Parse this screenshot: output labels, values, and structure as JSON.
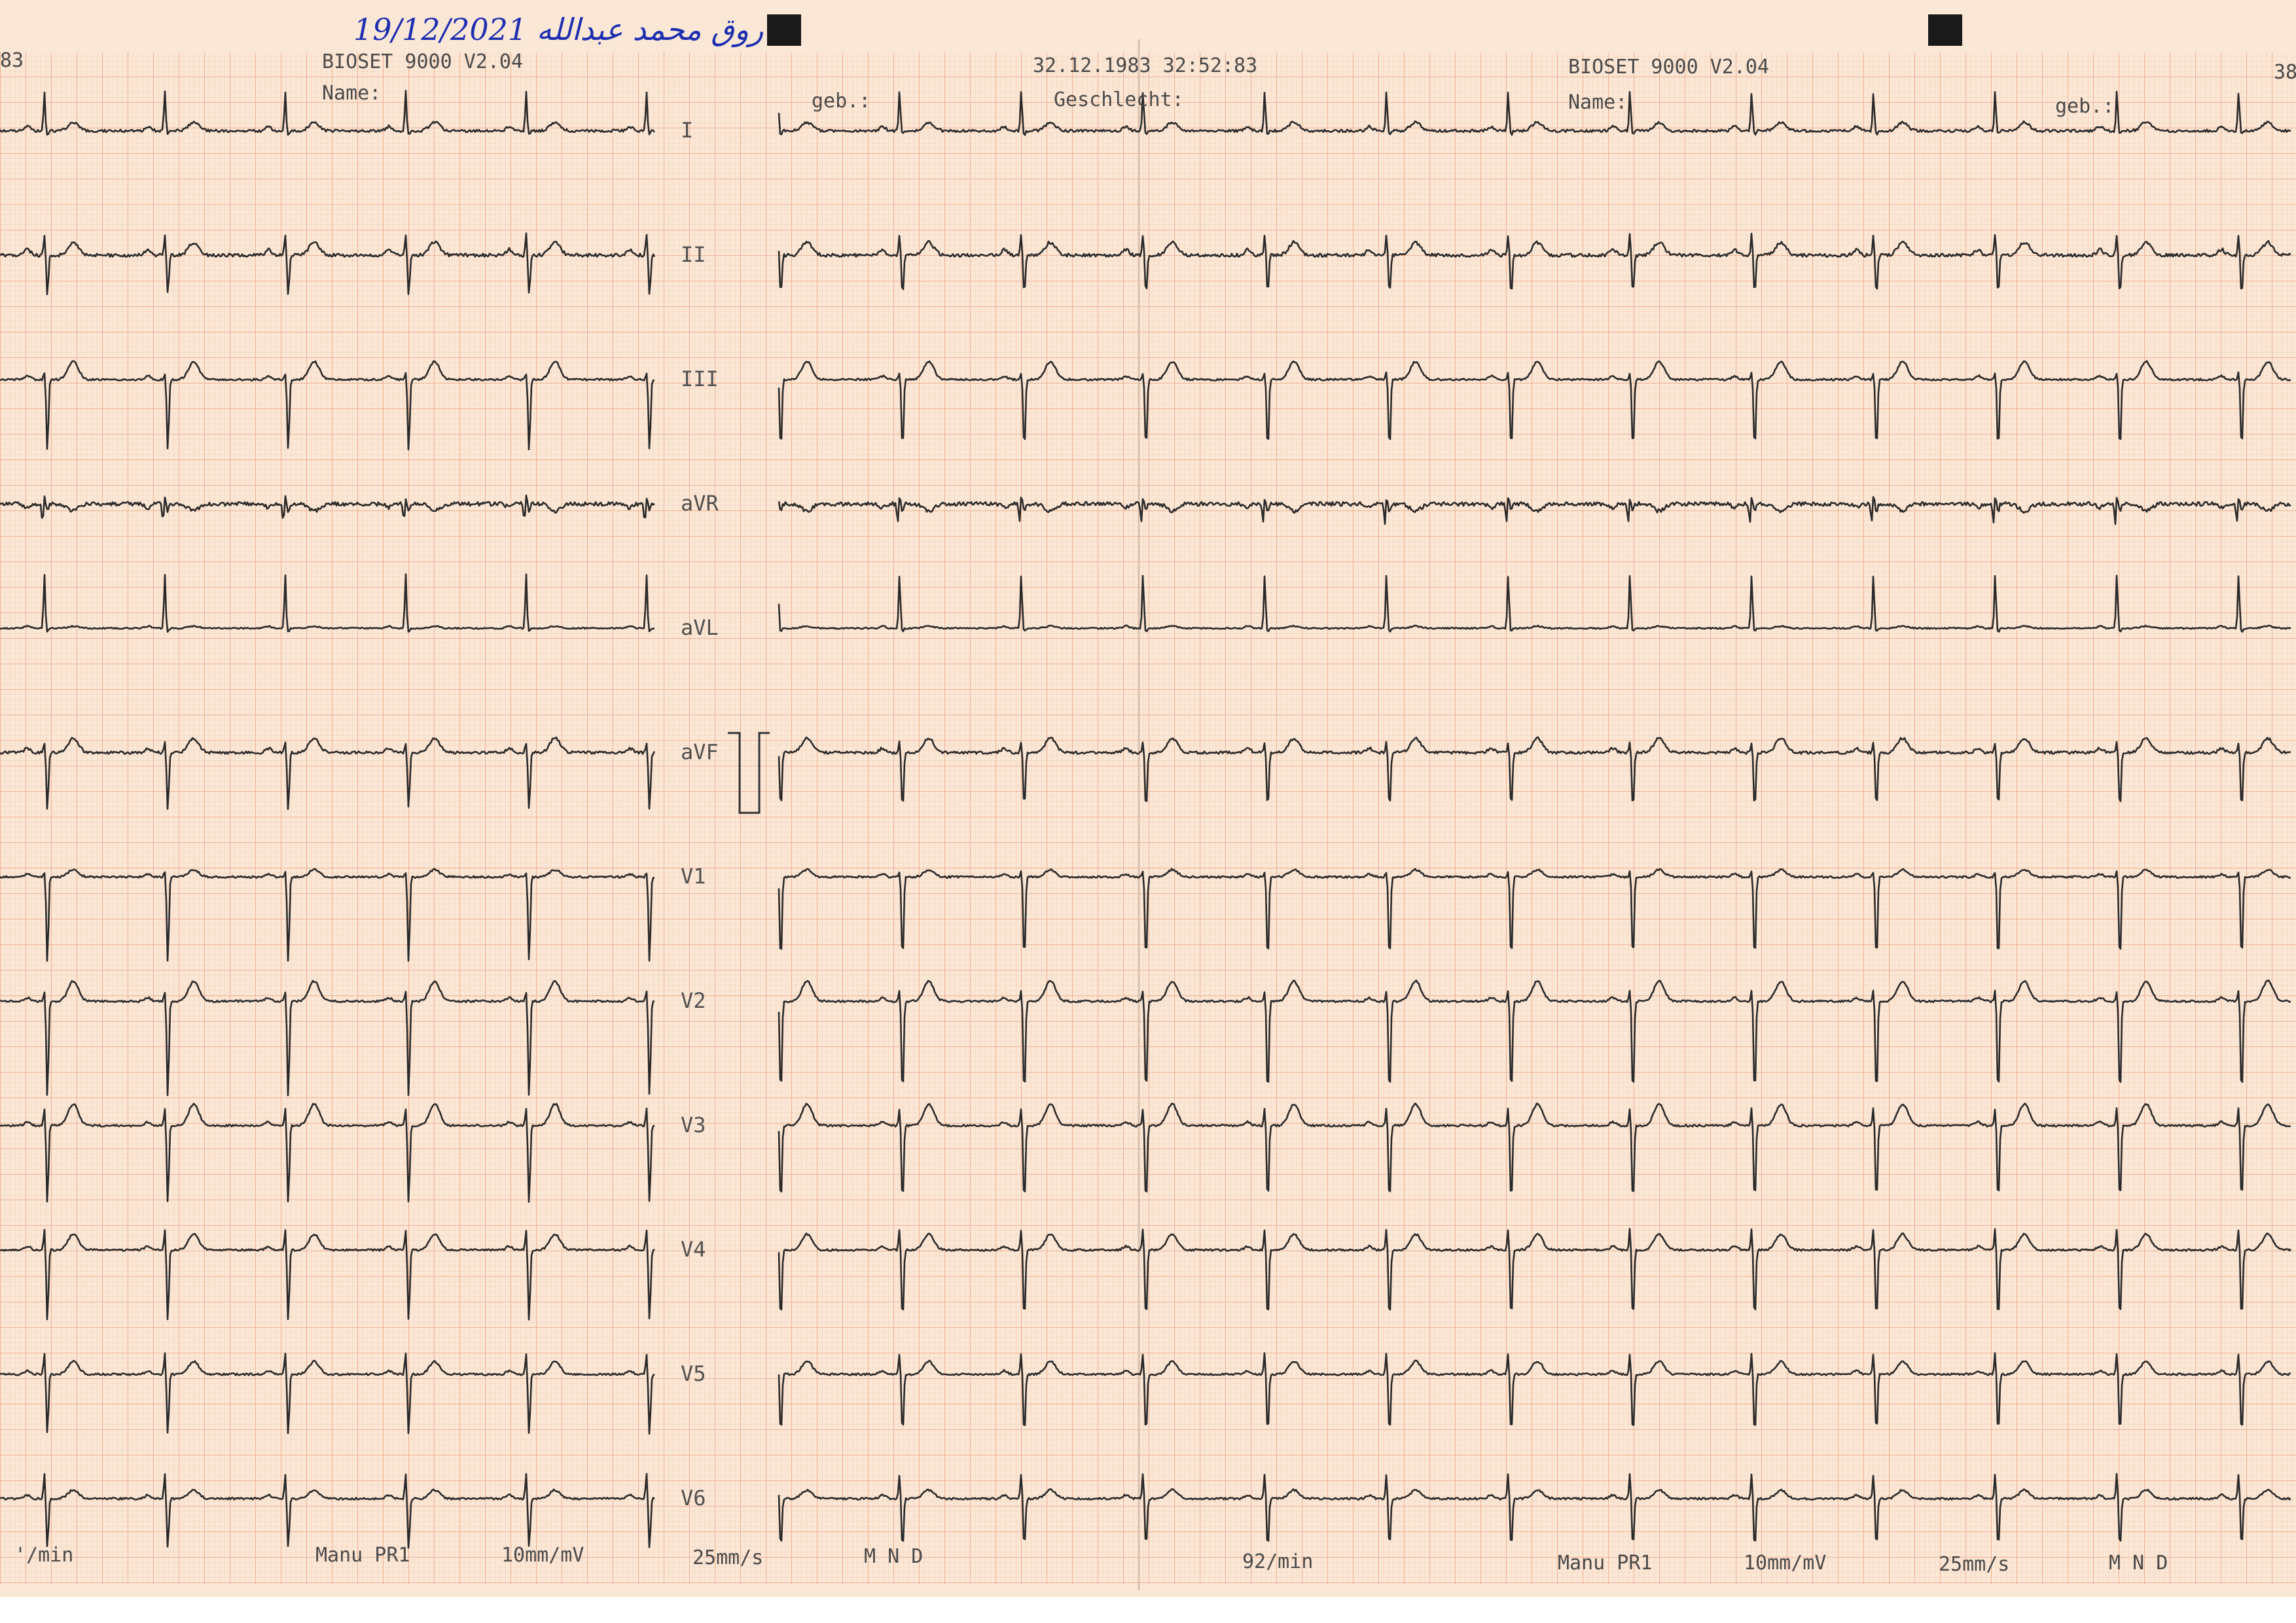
{
  "handwritten_note": "فاروق محمد عبدالله 19/12/2021",
  "header_left": {
    "number": "83",
    "device": "BIOSET 9000 V2.04",
    "name_label": "Name:",
    "geb_label": "geb.:",
    "datetime": "32.12.1983 32:52:83",
    "geschlecht_label": "Geschlecht:"
  },
  "header_right": {
    "device": "BIOSET 9000 V2.04",
    "name_label": "Name:",
    "geb_label": "geb.:",
    "number": "38"
  },
  "leads": [
    "I",
    "II",
    "III",
    "aVR",
    "aVL",
    "aVF",
    "V1",
    "V2",
    "V3",
    "V4",
    "V5",
    "V6"
  ],
  "footer_left": {
    "rate": "'/min",
    "mode": "Manu PR1",
    "gain": "10mm/mV",
    "speed": "25mm/s",
    "filters": "M  N  D"
  },
  "footer_right": {
    "rate": "92/min",
    "mode": "Manu PR1",
    "gain": "10mm/mV",
    "speed": "25mm/s",
    "filters": "M  N  D"
  },
  "colors": {
    "paper": "#fbe7d6",
    "grid_fine": "#f3c7a8",
    "grid_major": "#ec9a73",
    "trace": "#2a2a2a",
    "handwriting": "#1d2fb0"
  }
}
